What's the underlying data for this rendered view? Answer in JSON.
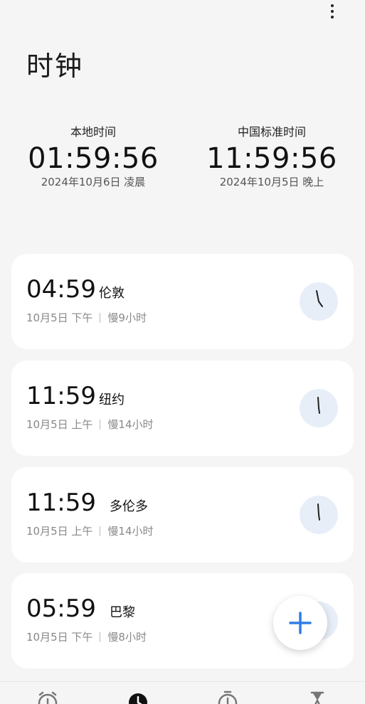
{
  "header": {
    "title": "时钟",
    "more_icon": "more-vert-icon"
  },
  "dual_clock": {
    "local": {
      "label": "本地时间",
      "time": "01:59:56",
      "date": "2024年10月6日 凌晨"
    },
    "home": {
      "label": "中国标准时间",
      "time": "11:59:56",
      "date": "2024年10月5日 晚上"
    }
  },
  "cities": [
    {
      "time": "04:59",
      "city": "伦敦",
      "date": "10月5日 下午",
      "offset": "慢9小时"
    },
    {
      "time": "11:59",
      "city": "纽约",
      "date": "10月5日 上午",
      "offset": "慢14小时"
    },
    {
      "time": "11:59",
      "city": "多伦多",
      "date": "10月5日 上午",
      "offset": "慢14小时"
    },
    {
      "time": "05:59",
      "city": "巴黎",
      "date": "10月5日 下午",
      "offset": "慢8小时"
    }
  ],
  "fab": {
    "icon": "plus-icon"
  },
  "colors": {
    "accent": "#2f7ee6",
    "card_bg": "#ffffff",
    "page_bg": "#f5f5f5",
    "clock_bg": "#e8eef8"
  },
  "bottom_nav": {
    "items": [
      {
        "icon": "alarm-icon",
        "selected": false
      },
      {
        "icon": "clock-icon",
        "selected": true
      },
      {
        "icon": "stopwatch-icon",
        "selected": false
      },
      {
        "icon": "timer-icon",
        "selected": false
      }
    ]
  }
}
